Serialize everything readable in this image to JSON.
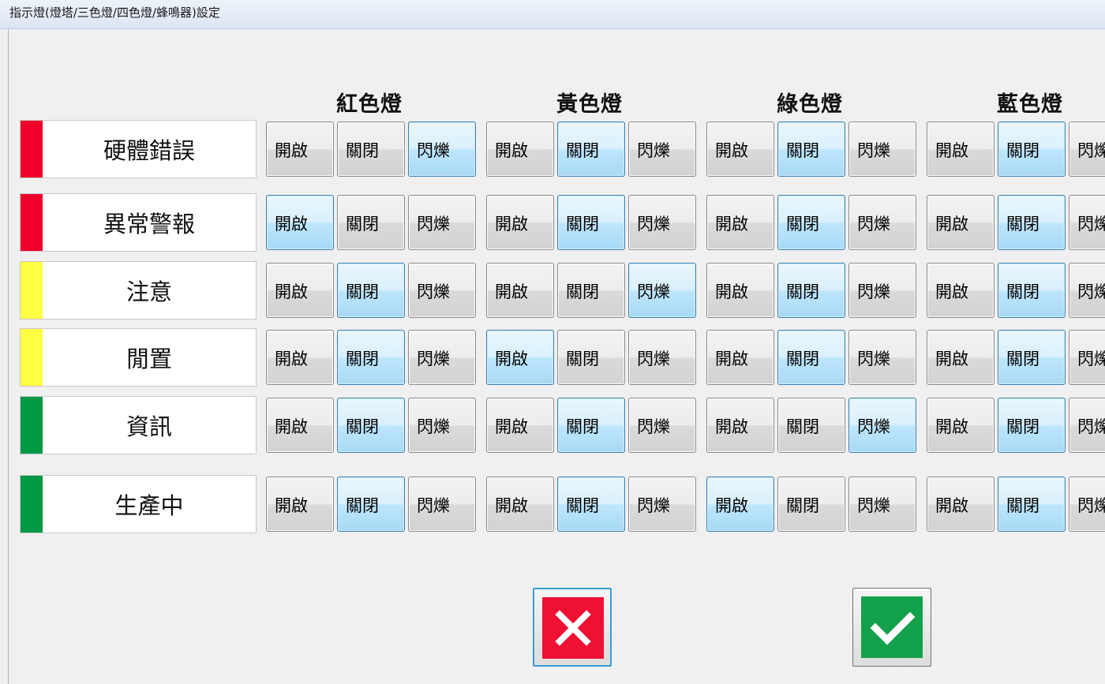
{
  "window": {
    "title": "指示燈(燈塔/三色燈/四色燈/蜂鳴器)設定"
  },
  "columns": [
    {
      "label": "紅色燈"
    },
    {
      "label": "黃色燈"
    },
    {
      "label": "綠色燈"
    },
    {
      "label": "藍色燈"
    }
  ],
  "option_labels": [
    "開啟",
    "關閉",
    "閃爍"
  ],
  "colors": {
    "red": "#f0002a",
    "yellow": "#ffff44",
    "green": "#009944",
    "selected_button": "#a7d9f5",
    "cancel": "#ee1133",
    "ok": "#13a14b"
  },
  "rows": [
    {
      "label": "硬體錯誤",
      "stripe": "#f0002a",
      "selected": [
        2,
        1,
        1,
        1
      ]
    },
    {
      "label": "異常警報",
      "stripe": "#f0002a",
      "selected": [
        0,
        1,
        1,
        1
      ]
    },
    {
      "label": "注意",
      "stripe": "#ffff44",
      "selected": [
        1,
        2,
        1,
        1
      ]
    },
    {
      "label": "閒置",
      "stripe": "#ffff44",
      "selected": [
        1,
        0,
        1,
        1
      ]
    },
    {
      "label": "資訊",
      "stripe": "#009944",
      "selected": [
        1,
        1,
        2,
        1
      ]
    },
    {
      "label": "生產中",
      "stripe": "#009944",
      "selected": [
        1,
        1,
        0,
        1
      ]
    }
  ],
  "actions": {
    "cancel_icon": "close-icon",
    "ok_icon": "checkmark-icon"
  }
}
